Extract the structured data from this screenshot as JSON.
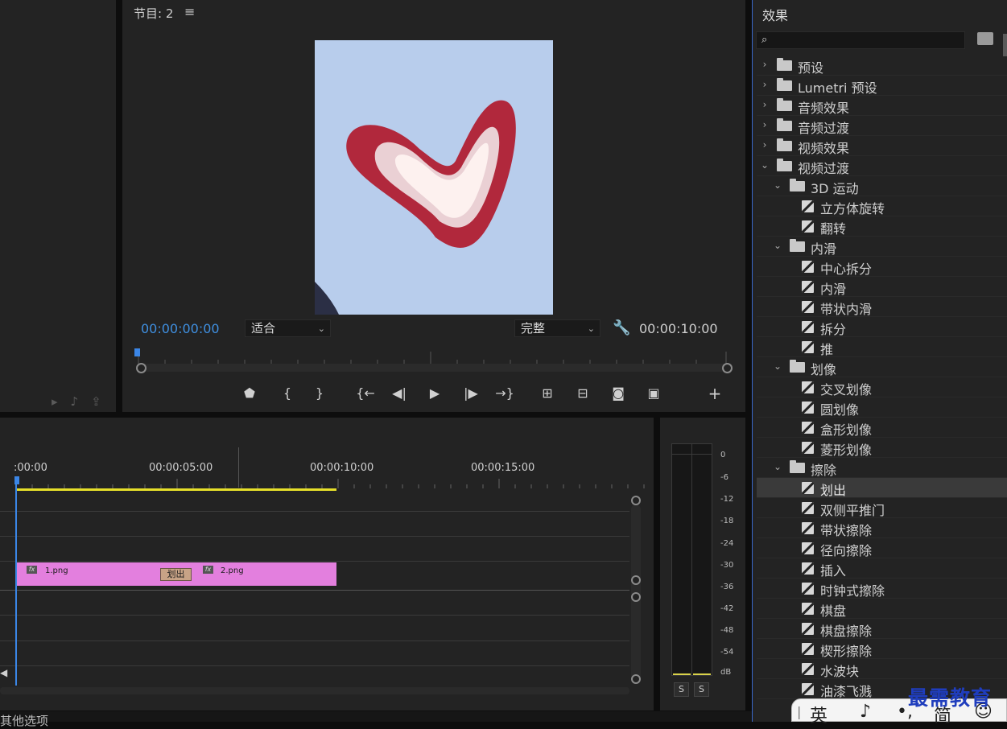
{
  "program_monitor": {
    "title": "节目: 2",
    "menu_icon": "≡",
    "timecode_current": "00:00:00:00",
    "fit_dropdown": "适合",
    "quality_dropdown": "完整",
    "timecode_duration": "00:00:10:00",
    "controls": {
      "marker": "marker-icon",
      "mark_in": "{",
      "mark_out": "}",
      "go_to_in": "go-to-in-icon",
      "step_back": "step-back-icon",
      "play": "play-icon",
      "step_forward": "step-forward-icon",
      "go_to_out": "go-to-out-icon",
      "lift": "lift-icon",
      "extract": "extract-icon",
      "export_frame": "camera-icon",
      "compare": "compare-icon",
      "add": "+"
    }
  },
  "timeline": {
    "ruler_labels": [
      ":00:00",
      "00:00:05:00",
      "00:00:10:00",
      "00:00:15:00"
    ],
    "clips": [
      {
        "name": "1.png",
        "fx": "fx"
      },
      {
        "name": "2.png",
        "fx": "fx"
      }
    ],
    "transition_label": "划出"
  },
  "audio_meter": {
    "db_labels": [
      "0",
      "-6",
      "-12",
      "-18",
      "-24",
      "-30",
      "-36",
      "-42",
      "-48",
      "-54",
      "dB"
    ],
    "solo_buttons": [
      "S",
      "S"
    ]
  },
  "effects_panel": {
    "title": "效果",
    "search_value": "",
    "tree": [
      {
        "label": "预设",
        "level": 0,
        "type": "preset-folder",
        "expanded": false
      },
      {
        "label": "Lumetri 预设",
        "level": 0,
        "type": "preset-folder",
        "expanded": false
      },
      {
        "label": "音频效果",
        "level": 0,
        "type": "folder",
        "expanded": false
      },
      {
        "label": "音频过渡",
        "level": 0,
        "type": "folder",
        "expanded": false
      },
      {
        "label": "视频效果",
        "level": 0,
        "type": "folder",
        "expanded": false
      },
      {
        "label": "视频过渡",
        "level": 0,
        "type": "folder",
        "expanded": true
      },
      {
        "label": "3D 运动",
        "level": 1,
        "type": "folder",
        "expanded": true
      },
      {
        "label": "立方体旋转",
        "level": 2,
        "type": "effect"
      },
      {
        "label": "翻转",
        "level": 2,
        "type": "effect"
      },
      {
        "label": "内滑",
        "level": 1,
        "type": "folder",
        "expanded": true
      },
      {
        "label": "中心拆分",
        "level": 2,
        "type": "effect"
      },
      {
        "label": "内滑",
        "level": 2,
        "type": "effect"
      },
      {
        "label": "带状内滑",
        "level": 2,
        "type": "effect"
      },
      {
        "label": "拆分",
        "level": 2,
        "type": "effect"
      },
      {
        "label": "推",
        "level": 2,
        "type": "effect"
      },
      {
        "label": "划像",
        "level": 1,
        "type": "folder",
        "expanded": true
      },
      {
        "label": "交叉划像",
        "level": 2,
        "type": "effect"
      },
      {
        "label": "圆划像",
        "level": 2,
        "type": "effect"
      },
      {
        "label": "盒形划像",
        "level": 2,
        "type": "effect"
      },
      {
        "label": "菱形划像",
        "level": 2,
        "type": "effect"
      },
      {
        "label": "擦除",
        "level": 1,
        "type": "folder",
        "expanded": true
      },
      {
        "label": "划出",
        "level": 2,
        "type": "effect",
        "selected": true
      },
      {
        "label": "双侧平推门",
        "level": 2,
        "type": "effect"
      },
      {
        "label": "带状擦除",
        "level": 2,
        "type": "effect"
      },
      {
        "label": "径向擦除",
        "level": 2,
        "type": "effect"
      },
      {
        "label": "插入",
        "level": 2,
        "type": "effect"
      },
      {
        "label": "时钟式擦除",
        "level": 2,
        "type": "effect"
      },
      {
        "label": "棋盘",
        "level": 2,
        "type": "effect"
      },
      {
        "label": "棋盘擦除",
        "level": 2,
        "type": "effect"
      },
      {
        "label": "楔形擦除",
        "level": 2,
        "type": "effect"
      },
      {
        "label": "水波块",
        "level": 2,
        "type": "effect"
      },
      {
        "label": "油漆飞溅",
        "level": 2,
        "type": "effect"
      }
    ]
  },
  "bottom_bar": {
    "partial_text": "其他选项"
  },
  "ime_bar": {
    "items": [
      "英",
      "♪",
      "•,",
      "简",
      "☺"
    ]
  },
  "watermark": "最需教育",
  "colors": {
    "accent_blue": "#3b86e6",
    "clip_pink": "#e37fde",
    "work_area_yellow": "#e6df2a",
    "transition_tan": "#c8a386"
  }
}
